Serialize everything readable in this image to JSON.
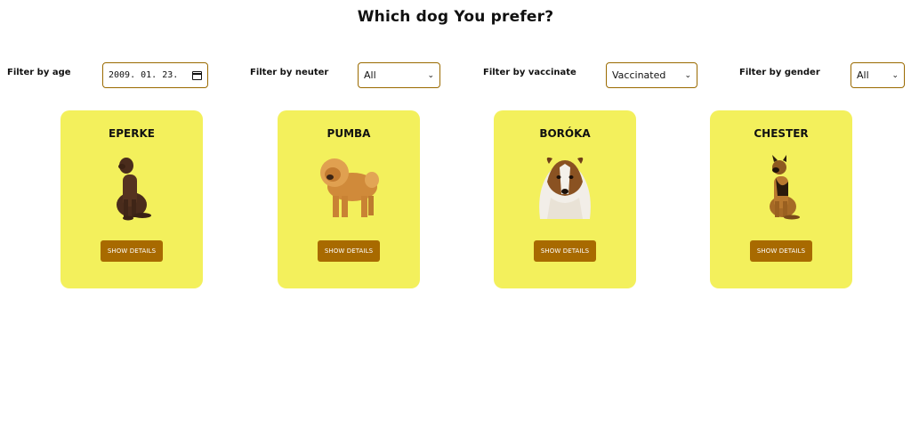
{
  "page": {
    "title": "Which dog You prefer?"
  },
  "filters": {
    "age": {
      "label": "Filter by age",
      "value": "2009. 01. 23."
    },
    "neuter": {
      "label": "Filter by neuter",
      "value": "All"
    },
    "vaccinate": {
      "label": "Filter by vaccinate",
      "value": "Vaccinated"
    },
    "gender": {
      "label": "Filter by gender",
      "value": "All"
    }
  },
  "cards": [
    {
      "name": "EPERKE",
      "button": "SHOW DETAILS",
      "image": "dog-photo"
    },
    {
      "name": "PUMBA",
      "button": "SHOW DETAILS",
      "image": "dog-photo"
    },
    {
      "name": "BORÓKA",
      "button": "SHOW DETAILS",
      "image": "dog-photo"
    },
    {
      "name": "CHESTER",
      "button": "SHOW DETAILS",
      "image": "dog-photo"
    }
  ],
  "colors": {
    "card_bg": "#f3f05c",
    "button_bg": "#a86a00",
    "control_border": "#9a6a00"
  }
}
